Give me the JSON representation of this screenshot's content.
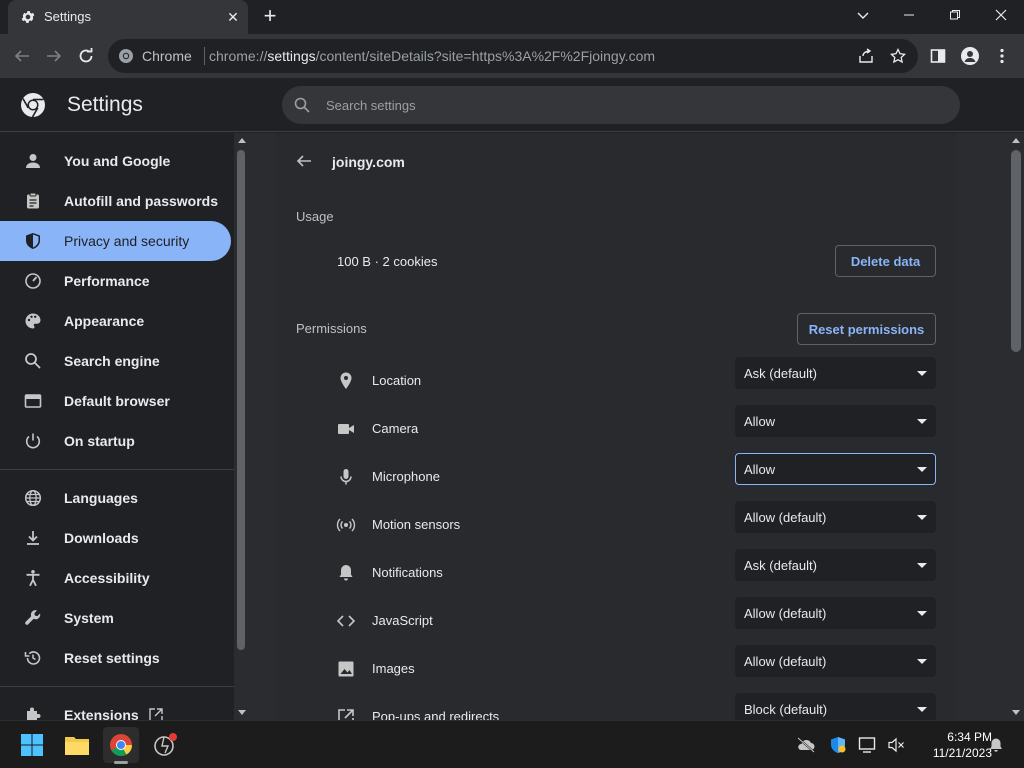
{
  "browser": {
    "tab_title": "Settings",
    "omnibox_chip": "Chrome",
    "url_scheme": "chrome://",
    "url_host": "settings",
    "url_path": "/content/siteDetails?site=https%3A%2F%2Fjoingy.com"
  },
  "header": {
    "title": "Settings",
    "search_placeholder": "Search settings"
  },
  "sidebar": {
    "items": [
      {
        "label": "You and Google",
        "icon": "person-icon"
      },
      {
        "label": "Autofill and passwords",
        "icon": "clipboard-icon"
      },
      {
        "label": "Privacy and security",
        "icon": "shield-icon",
        "active": true
      },
      {
        "label": "Performance",
        "icon": "speedometer-icon"
      },
      {
        "label": "Appearance",
        "icon": "palette-icon"
      },
      {
        "label": "Search engine",
        "icon": "search-icon"
      },
      {
        "label": "Default browser",
        "icon": "browser-window-icon"
      },
      {
        "label": "On startup",
        "icon": "power-icon"
      },
      {
        "label": "Languages",
        "icon": "globe-icon"
      },
      {
        "label": "Downloads",
        "icon": "download-icon"
      },
      {
        "label": "Accessibility",
        "icon": "accessibility-icon"
      },
      {
        "label": "System",
        "icon": "wrench-icon"
      },
      {
        "label": "Reset settings",
        "icon": "reset-icon"
      },
      {
        "label": "Extensions",
        "icon": "puzzle-icon"
      }
    ]
  },
  "site": {
    "name": "joingy.com",
    "usage_title": "Usage",
    "usage_value": "100 B · 2 cookies",
    "delete_button": "Delete data",
    "permissions_title": "Permissions",
    "reset_button": "Reset permissions",
    "permissions": [
      {
        "label": "Location",
        "value": "Ask (default)",
        "icon": "location-pin-icon"
      },
      {
        "label": "Camera",
        "value": "Allow",
        "icon": "camera-icon"
      },
      {
        "label": "Microphone",
        "value": "Allow",
        "icon": "microphone-icon",
        "focused": true
      },
      {
        "label": "Motion sensors",
        "value": "Allow (default)",
        "icon": "motion-sensor-icon"
      },
      {
        "label": "Notifications",
        "value": "Ask (default)",
        "icon": "bell-icon"
      },
      {
        "label": "JavaScript",
        "value": "Allow (default)",
        "icon": "code-icon"
      },
      {
        "label": "Images",
        "value": "Allow (default)",
        "icon": "image-icon"
      },
      {
        "label": "Pop-ups and redirects",
        "value": "Block (default)",
        "icon": "open-external-icon"
      }
    ]
  },
  "taskbar": {
    "time": "6:34 PM",
    "date": "11/21/2023"
  },
  "colors": {
    "accent": "#8ab4f8",
    "background": "#202124",
    "surface": "#292a2d"
  }
}
